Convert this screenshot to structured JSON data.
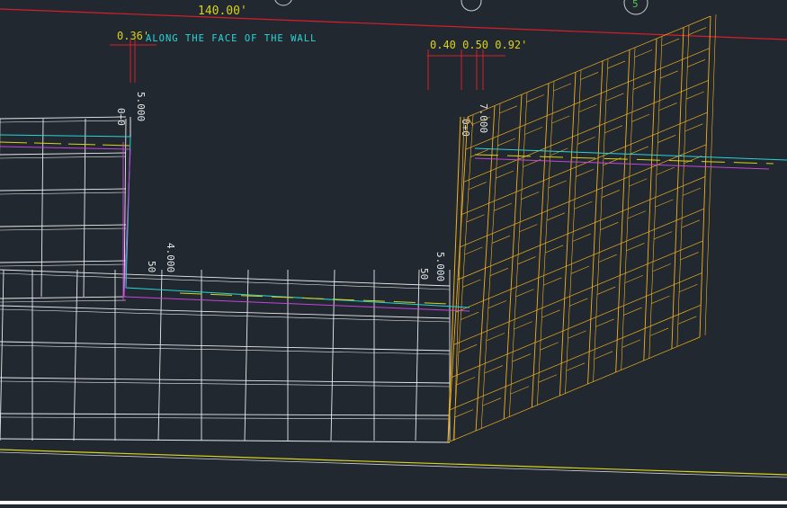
{
  "viewport": {
    "background": "#212830",
    "colors": {
      "white_grid": "#e9e9e9",
      "orange_grid": "#f2b01e",
      "red_line": "#d61f2a",
      "yellow_line": "#d9d21c",
      "cyan_line": "#2ad4d4",
      "magenta_line": "#c246d6",
      "dim_text": "#cfcfcf",
      "green_circle": "#57c25a"
    }
  },
  "annotations": {
    "top_dimension": "140.00'",
    "note_along_face": "ALONG THE FACE OF THE WALL",
    "left_dim_label": "0.36'",
    "right_dim_label": "0.40 0.50 0.92'",
    "marker_number_5": "5"
  },
  "stations": {
    "left_top_a": "0+0",
    "left_top_b": "5.000",
    "mid_left_a": "50",
    "mid_left_b": "4.000",
    "mid_right_a": "50",
    "mid_right_b": "5.000",
    "right_top_a": "0+0",
    "right_top_b": "7.000"
  }
}
